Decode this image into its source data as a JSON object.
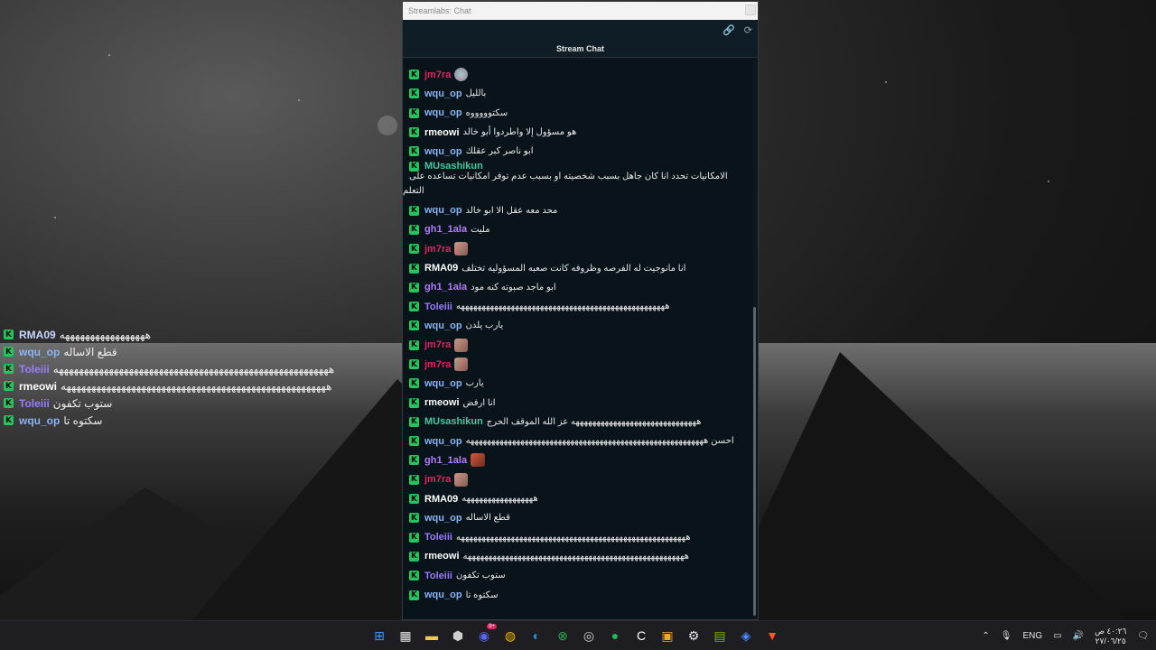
{
  "window": {
    "title": "Streamlabs: Chat",
    "header": "Stream Chat",
    "link_icon": "link-icon",
    "refresh_icon": "refresh-icon"
  },
  "chat": {
    "messages": [
      {
        "user": "jm7ra",
        "color": "#e0245e",
        "text": "",
        "emote": "round"
      },
      {
        "user": "wqu_op",
        "color": "#8ab4f8",
        "text": "بالليل"
      },
      {
        "user": "wqu_op",
        "color": "#8ab4f8",
        "text": "سكتوووووه"
      },
      {
        "user": "rmeowi",
        "color": "#ffffff",
        "text": "هو مسؤول إلا واطردوا أبو خالد"
      },
      {
        "user": "wqu_op",
        "color": "#8ab4f8",
        "text": "ابو ناصر كبر عقلك"
      },
      {
        "user": "MUsashikun",
        "color": "#40c9a2",
        "text": "الامكانيات تحدد انا كان جاهل بسبب شخصيته او بسبب عدم توفر امكانيات تساعده على",
        "wrap": "التعلم"
      },
      {
        "user": "wqu_op",
        "color": "#8ab4f8",
        "text": "محد معه عقل الا ابو خالد"
      },
      {
        "user": "gh1_1ala",
        "color": "#b57bff",
        "text": "مليت"
      },
      {
        "user": "jm7ra",
        "color": "#e0245e",
        "text": "",
        "emote": "square"
      },
      {
        "user": "RMA09",
        "color": "#ffffff",
        "text": "انا مانوجيت له الفرصه وظروفه كانت صعبه المسؤوليه تختلف"
      },
      {
        "user": "gh1_1ala",
        "color": "#b57bff",
        "text": "ابو ماجد صبوته كنه مود"
      },
      {
        "user": "Toleiii",
        "color": "#9b7bff",
        "text": "ههههههههههههههههههههههههههههههههههههههههههههههههههه"
      },
      {
        "user": "wqu_op",
        "color": "#8ab4f8",
        "text": "يارب يلدن"
      },
      {
        "user": "jm7ra",
        "color": "#e0245e",
        "text": "",
        "emote": "square"
      },
      {
        "user": "jm7ra",
        "color": "#e0245e",
        "text": "",
        "emote": "square"
      },
      {
        "user": "wqu_op",
        "color": "#8ab4f8",
        "text": "يارب"
      },
      {
        "user": "rmeowi",
        "color": "#ffffff",
        "text": "انا ارفض"
      },
      {
        "user": "MUsashikun",
        "color": "#40c9a2",
        "text": "ههههههههههههههههههههههههههههههه عز الله الموقف الحرج"
      },
      {
        "user": "wqu_op",
        "color": "#8ab4f8",
        "text": "احسن هههههههههههههههههههههههههههههههههههههههههههههههههههههههههه"
      },
      {
        "user": "gh1_1ala",
        "color": "#b57bff",
        "text": "",
        "emote": "wide"
      },
      {
        "user": "jm7ra",
        "color": "#e0245e",
        "text": "",
        "emote": "square"
      },
      {
        "user": "RMA09",
        "color": "#ffffff",
        "text": "هههههههههههههههههه"
      },
      {
        "user": "wqu_op",
        "color": "#8ab4f8",
        "text": "قطع الاساله"
      },
      {
        "user": "Toleiii",
        "color": "#9b7bff",
        "text": "هههههههههههههههههههههههههههههههههههههههههههههههههههههههه"
      },
      {
        "user": "rmeowi",
        "color": "#ffffff",
        "text": "هههههههههههههههههههههههههههههههههههههههههههههههههههههه"
      },
      {
        "user": "Toleiii",
        "color": "#9b7bff",
        "text": "ستوب تكفون"
      },
      {
        "user": "wqu_op",
        "color": "#8ab4f8",
        "text": "سكتوه تا"
      }
    ]
  },
  "overlay": {
    "messages": [
      {
        "user": "RMA09",
        "color": "#c9d6ff",
        "text": "هههههههههههههههههه"
      },
      {
        "user": "wqu_op",
        "color": "#8ab4f8",
        "text": "قطع الاساله"
      },
      {
        "user": "Toleiii",
        "color": "#9b7bff",
        "text": "هههههههههههههههههههههههههههههههههههههههههههههههههههههههه"
      },
      {
        "user": "rmeowi",
        "color": "#ffffff",
        "text": "هههههههههههههههههههههههههههههههههههههههههههههههههههههه"
      },
      {
        "user": "Toleiii",
        "color": "#9b7bff",
        "text": "ستوب تكفون"
      },
      {
        "user": "wqu_op",
        "color": "#8ab4f8",
        "text": "سكتوه تا"
      }
    ]
  },
  "badge_letter": "K",
  "taskbar": {
    "apps": [
      "windows-start-icon",
      "store-icon",
      "file-explorer-icon",
      "steam-helper-icon",
      "discord-icon",
      "chrome-icon",
      "steam-icon",
      "xbox-icon",
      "obs-icon",
      "spotify-icon",
      "ccleaner-icon",
      "media-icon",
      "settings-icon",
      "nvidia-icon",
      "app-icon",
      "brave-icon"
    ],
    "discord_badge": "9+",
    "language": "ENG",
    "time": "٤٠:٢٦ ص",
    "date": "٢٧/٠٦/٢٥"
  }
}
